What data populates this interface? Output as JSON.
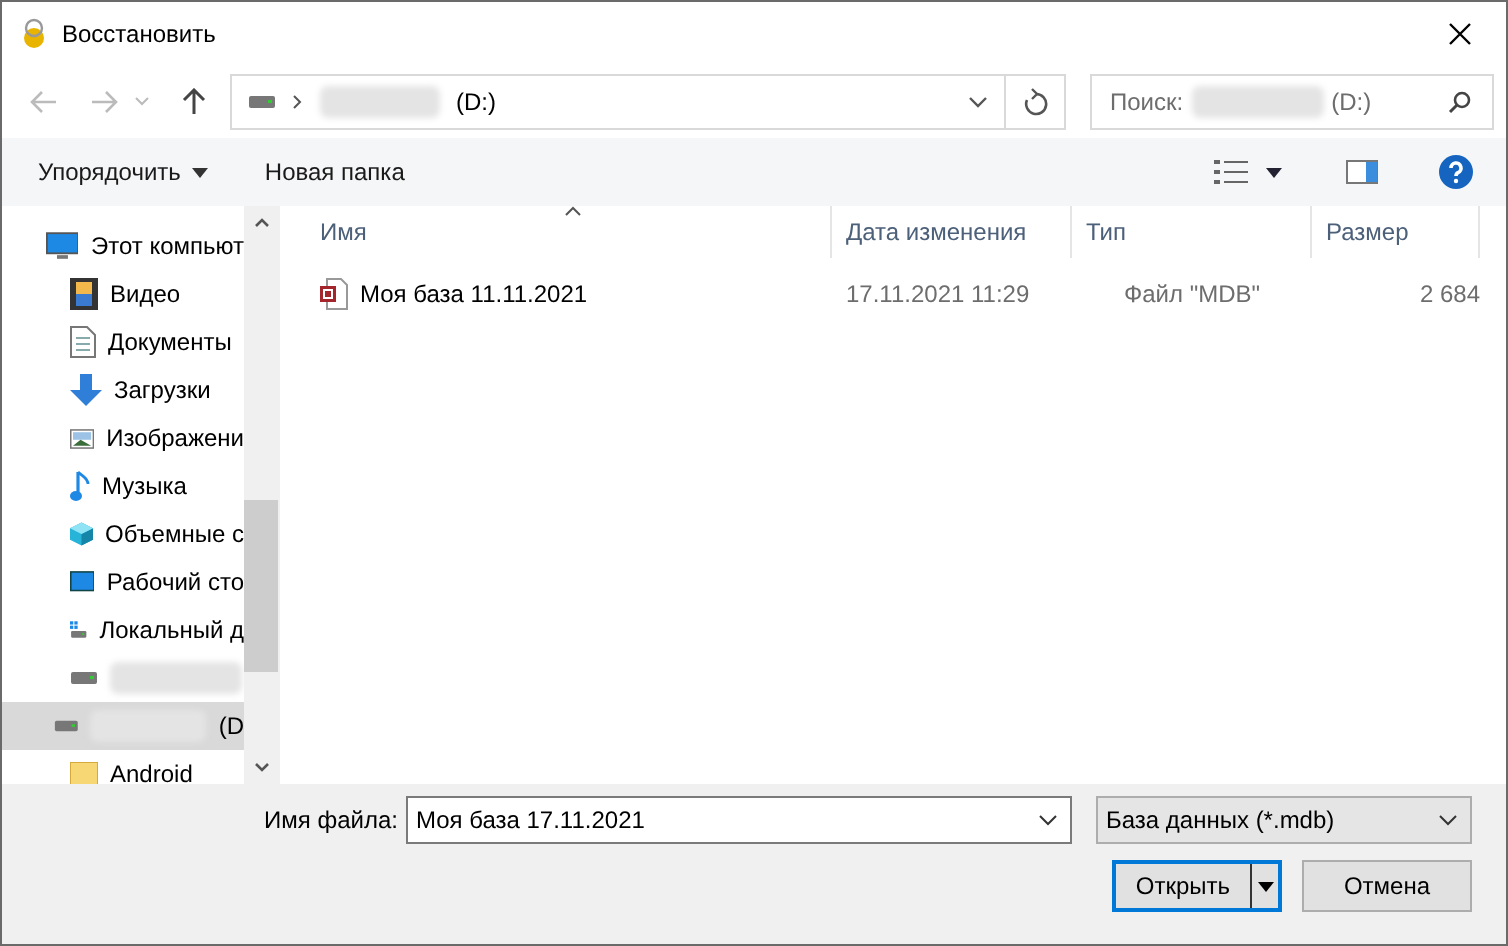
{
  "window": {
    "title": "Восстановить"
  },
  "address": {
    "drive": "(D:)",
    "name_blurred": true
  },
  "search": {
    "placeholder": "Поиск:",
    "drive": "(D:)",
    "name_blurred": true
  },
  "toolbar": {
    "organize": "Упорядочить",
    "new_folder": "Новая папка"
  },
  "sidebar": {
    "items": [
      {
        "kind": "computer",
        "label": "Этот компьют",
        "selected": false,
        "children": [
          {
            "kind": "video",
            "label": "Видео",
            "selected": false
          },
          {
            "kind": "docs",
            "label": "Документы",
            "selected": false
          },
          {
            "kind": "downloads",
            "label": "Загрузки",
            "selected": false
          },
          {
            "kind": "images",
            "label": "Изображени",
            "selected": false
          },
          {
            "kind": "music",
            "label": "Музыка",
            "selected": false
          },
          {
            "kind": "objects",
            "label": "Объемные с",
            "selected": false
          },
          {
            "kind": "desktop",
            "label": "Рабочий сто",
            "selected": false
          },
          {
            "kind": "localdisk",
            "label": "Локальный д",
            "selected": false
          },
          {
            "kind": "drive",
            "label_blurred": true,
            "selected": false
          }
        ]
      },
      {
        "kind": "drive",
        "label": "(D",
        "label_blurred": true,
        "selected": true,
        "children": [
          {
            "kind": "folder",
            "label": "Android",
            "selected": false
          }
        ]
      }
    ]
  },
  "table": {
    "columns": [
      "Имя",
      "Дата изменения",
      "Тип",
      "Размер"
    ],
    "rows": [
      {
        "kind": "mdb",
        "name": "Моя база 11.11.2021",
        "date": "17.11.2021 11:29",
        "type": "Файл \"MDB\"",
        "size": "2 684",
        "selected": false
      }
    ]
  },
  "footer": {
    "filename_label": "Имя файла:",
    "filename": "Моя база 17.11.2021",
    "filetype": "База данных (*.mdb)",
    "open": "Открыть",
    "cancel": "Отмена"
  }
}
